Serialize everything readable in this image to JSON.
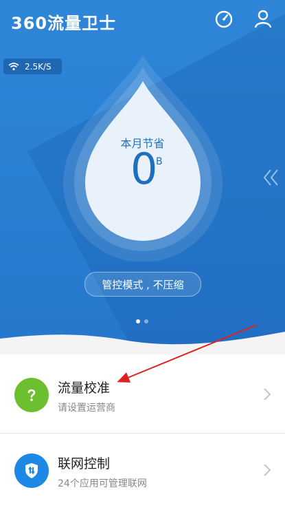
{
  "header": {
    "app_title": "360流量卫士",
    "speed_icon": "speedometer-icon",
    "user_icon": "user-icon"
  },
  "network": {
    "wifi_icon": "wifi-icon",
    "speed": "2.5K/S"
  },
  "savings": {
    "label": "本月节省",
    "value": "0",
    "unit": "B"
  },
  "mode": {
    "label": "管控模式 , 不压缩"
  },
  "pager": {
    "count": 2,
    "active": 0
  },
  "cards": [
    {
      "title": "流量校准",
      "subtitle": "请设置运营商",
      "icon": "question-icon",
      "color": "#6cc02f"
    },
    {
      "title": "联网控制",
      "subtitle": "24个应用可管理联网",
      "icon": "shield-icon",
      "color": "#1e88e5"
    }
  ],
  "colors": {
    "header_blue": "#2a7fd3",
    "arrow_red": "#e02020"
  }
}
